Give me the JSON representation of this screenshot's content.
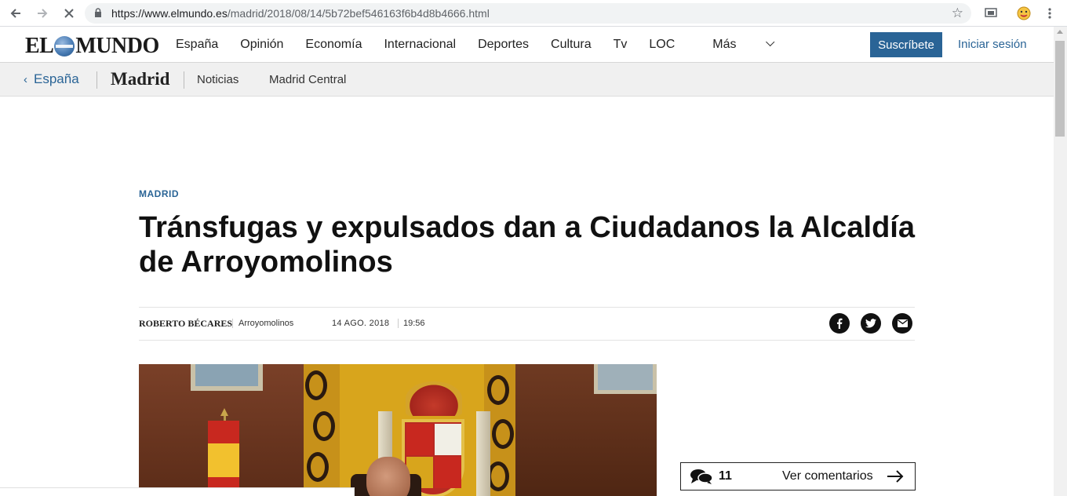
{
  "browser": {
    "url_host": "https://www.elmundo.es",
    "url_path": "/madrid/2018/08/14/5b72bef546163f6b4d8b4666.html"
  },
  "site": {
    "logo_left": "EL",
    "logo_right": "MUNDO",
    "nav": [
      "España",
      "Opinión",
      "Economía",
      "Internacional",
      "Deportes",
      "Cultura",
      "Tv",
      "LOC",
      "Más"
    ],
    "subscribe": "Suscríbete",
    "login": "Iniciar sesión",
    "accent": "#2a6496"
  },
  "section": {
    "back": "España",
    "title": "Madrid",
    "links": [
      "Noticias",
      "Madrid Central"
    ]
  },
  "article": {
    "kicker": "MADRID",
    "headline": "Tránsfugas y expulsados dan a Ciudadanos la Alcaldía de Arroyomolinos",
    "author": "ROBERTO BÉCARES",
    "place": "Arroyomolinos",
    "date": "14 AGO. 2018",
    "time": "19:56"
  },
  "comments": {
    "count": "11",
    "label": "Ver comentarios"
  }
}
